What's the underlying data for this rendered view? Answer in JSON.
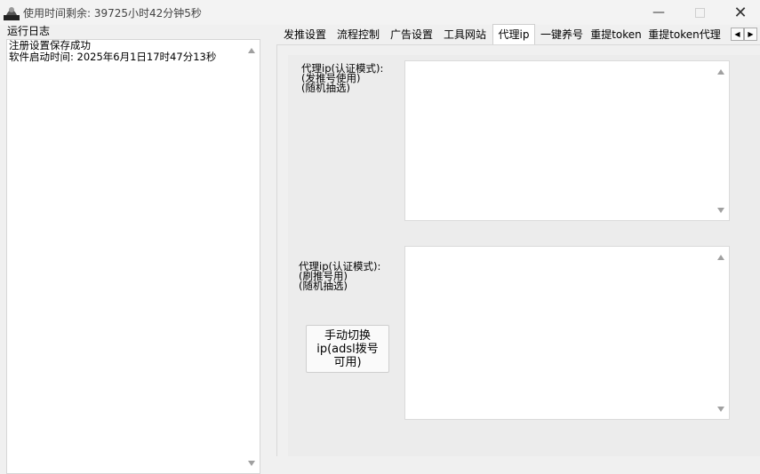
{
  "window": {
    "title": "使用时间剩余:  39725小时42分钟5秒",
    "min_symbol": "—",
    "close_symbol": "✕"
  },
  "log": {
    "group_title": "运行日志",
    "lines": [
      "注册设置保存成功",
      "软件启动时间: 2025年6月1日17时47分13秒"
    ]
  },
  "tabs": [
    {
      "label": "发推设置"
    },
    {
      "label": "流程控制"
    },
    {
      "label": "广告设置"
    },
    {
      "label": "工具网站"
    },
    {
      "label": "代理ip"
    },
    {
      "label": "一键养号"
    },
    {
      "label": "重提token"
    },
    {
      "label": "重提token代理"
    }
  ],
  "tab_scroll": {
    "left": "◀",
    "right": "▶"
  },
  "proxy_tab": {
    "post_label": [
      "代理ip(认证模式):",
      "(发推号使用)",
      "(随机抽选)"
    ],
    "post_value": "",
    "brush_label": [
      "代理ip(认证模式):",
      "(刷推号用)",
      "(随机抽选)"
    ],
    "brush_value": "",
    "switch_button": [
      "手动切换",
      "ip(adsl拨号",
      "可用)"
    ]
  },
  "colors": {
    "background": "#f0f0f0",
    "field": "#ffffff",
    "border": "#d6d6d6"
  }
}
